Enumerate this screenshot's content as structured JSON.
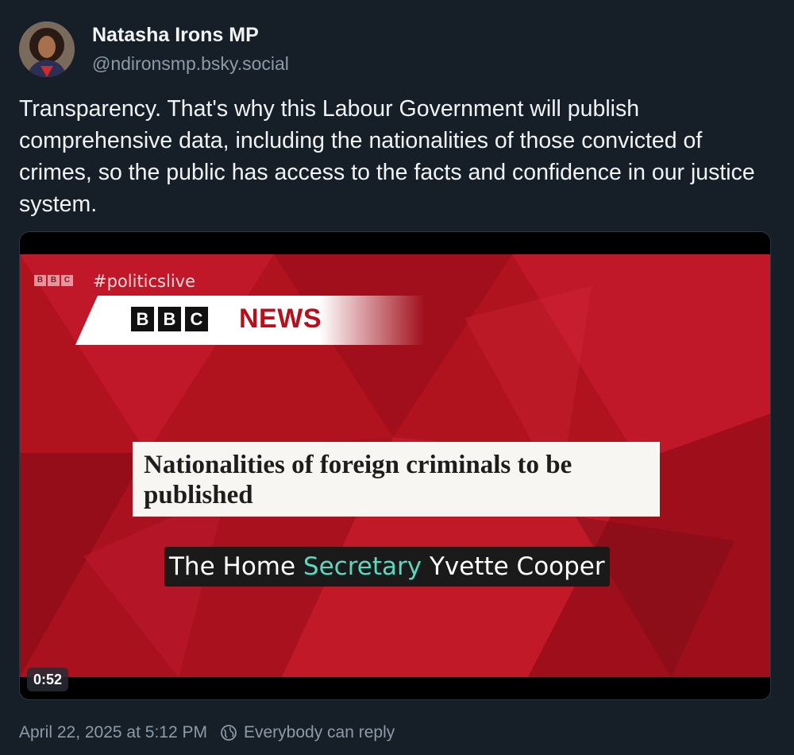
{
  "author": {
    "display_name": "Natasha Irons MP",
    "handle": "@ndironsmp.bsky.social",
    "avatar_icon": "profile-photo"
  },
  "post": {
    "text": "Transparency. That's why this Labour Government will publish comprehensive data, including the nationalities of those convicted of crimes, so the public has access to the facts and confidence in our justice system."
  },
  "video": {
    "bbc_small": [
      "B",
      "B",
      "C"
    ],
    "hashtag": "#politicslive",
    "bbc_logo_letters": [
      "B",
      "B",
      "C"
    ],
    "news_word": "NEWS",
    "headline": "Nationalities of foreign criminals to be published",
    "caption_before": "The Home ",
    "caption_highlight": "Secretary",
    "caption_after": " Yvette Cooper",
    "duration": "0:52"
  },
  "footer": {
    "timestamp": "April 22, 2025 at 5:12 PM",
    "reply_setting": "Everybody can reply",
    "reply_icon": "globe-icon"
  },
  "colors": {
    "background": "#161e27",
    "text": "#f1f3f5",
    "muted": "#8d9aa8",
    "bbc_red": "#b80f1d",
    "caption_highlight": "#5fd6c0"
  }
}
